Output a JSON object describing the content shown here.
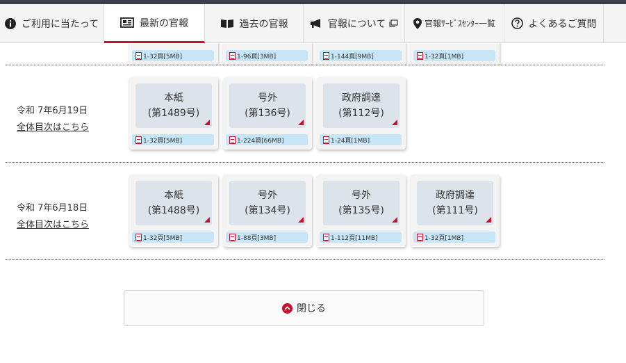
{
  "nav": {
    "items": [
      {
        "label": "ご利用に当たって",
        "icon": "info-icon"
      },
      {
        "label": "最新の官報",
        "icon": "newspaper-icon",
        "active": true
      },
      {
        "label": "過去の官報",
        "icon": "book-icon"
      },
      {
        "label": "官報について",
        "icon": "megaphone-icon",
        "suffix_icon": "external-window-icon"
      },
      {
        "label": "官報ｻｰﾋﾞｽｾﾝﾀｰ一覧",
        "icon": "location-pin-icon"
      },
      {
        "label": "よくあるご質問",
        "icon": "question-icon"
      }
    ]
  },
  "partial_row": {
    "pdf_labels": [
      "1-32頁[5MB]",
      "1-96頁[3MB]",
      "1-144頁[9MB]",
      "1-32頁[1MB]"
    ]
  },
  "rows": [
    {
      "date": "令和 7年6月19日",
      "toc_link": "全体目次はこちら",
      "issues": [
        {
          "type": "本紙",
          "number": "(第1489号)",
          "pdf": "1-32頁[5MB]"
        },
        {
          "type": "号外",
          "number": "(第136号)",
          "pdf": "1-224頁[66MB]"
        },
        {
          "type": "政府調達",
          "number": "(第112号)",
          "pdf": "1-24頁[1MB]"
        }
      ]
    },
    {
      "date": "令和 7年6月18日",
      "toc_link": "全体目次はこちら",
      "issues": [
        {
          "type": "本紙",
          "number": "(第1488号)",
          "pdf": "1-32頁[5MB]"
        },
        {
          "type": "号外",
          "number": "(第134号)",
          "pdf": "1-88頁[3MB]"
        },
        {
          "type": "号外",
          "number": "(第135号)",
          "pdf": "1-112頁[11MB]"
        },
        {
          "type": "政府調達",
          "number": "(第111号)",
          "pdf": "1-32頁[1MB]"
        }
      ]
    }
  ],
  "close_button": {
    "label": "閉じる",
    "icon": "chevron-up-icon"
  },
  "colors": {
    "accent": "#c8102e",
    "card_bg": "#dde3ea",
    "pdf_bg": "#c6e5f7"
  }
}
